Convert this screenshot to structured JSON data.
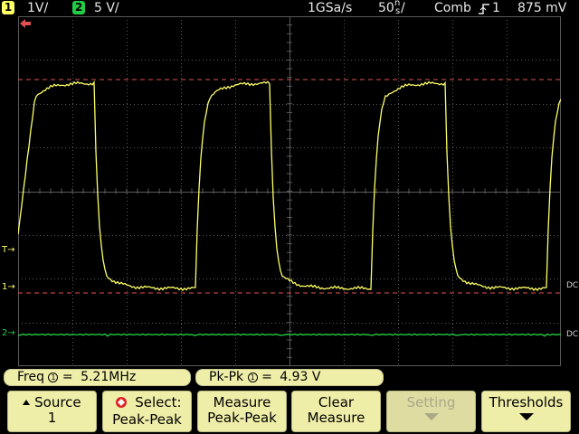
{
  "status": {
    "ch1_number": "1",
    "ch1_scale": "1V/",
    "ch2_number": "2",
    "ch2_scale": "5 V/",
    "sample_rate": "1GSa/s",
    "timebase_value": "50",
    "timebase_unit_top": "n",
    "timebase_unit_bottom": "s",
    "trigger_mode": "Comb",
    "trigger_channel": "1",
    "trigger_level": "875 mV"
  },
  "markers": {
    "trigger_marker": "T",
    "ch1_marker": "1",
    "ch2_marker": "2",
    "right_label_1": "DC",
    "right_label_2": "DC"
  },
  "measurements": [
    {
      "label": "Freq",
      "source": "1",
      "value": "5.21MHz"
    },
    {
      "label": "Pk-Pk",
      "source": "1",
      "value": "4.93 V"
    }
  ],
  "softkeys": [
    {
      "line1": "Source",
      "line2": "1",
      "arrow": "up",
      "enabled": true
    },
    {
      "line1": "Select:",
      "line2": "Peak-Peak",
      "icon": "measure-select-icon",
      "enabled": true
    },
    {
      "line1": "Measure",
      "line2": "Peak-Peak",
      "enabled": true
    },
    {
      "line1": "Clear",
      "line2": "Measure",
      "enabled": true
    },
    {
      "line1": "Setting",
      "line2": "",
      "arrow": "down",
      "enabled": false
    },
    {
      "line1": "Thresholds",
      "line2": "",
      "arrow": "down",
      "enabled": true
    }
  ],
  "colors": {
    "ch1": "#ffff66",
    "ch2": "#22cc44",
    "grid": "#5a5a5a",
    "cursor": "#e05050",
    "softkey_bg": "#efeea8"
  }
}
